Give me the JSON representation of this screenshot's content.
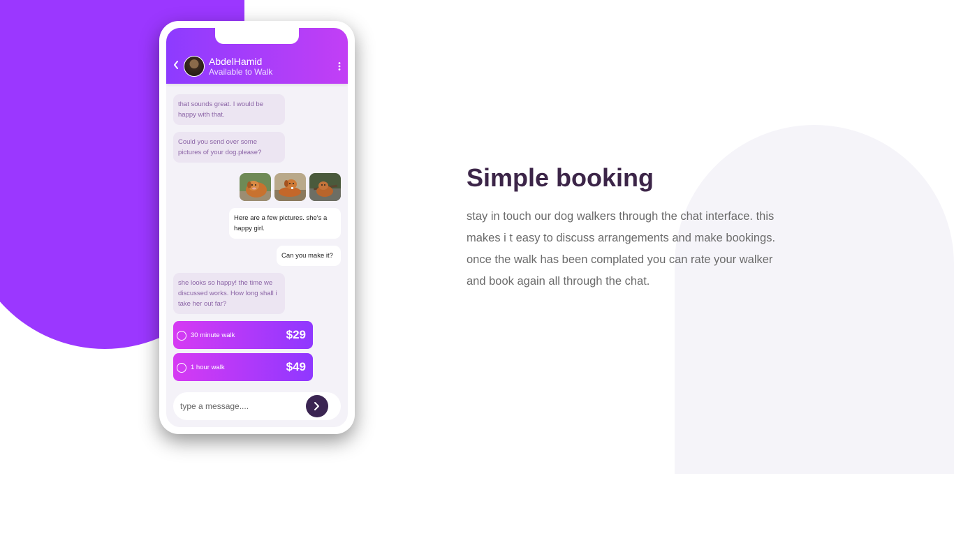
{
  "chat": {
    "contact_name": "AbdelHamid",
    "contact_status": "Available to Walk",
    "messages": [
      {
        "side": "in",
        "text": "that sounds great. I would be happy with that."
      },
      {
        "side": "in",
        "text": "Could you send over some pictures of your dog.please?"
      },
      {
        "side": "out",
        "text": "Here are a few pictures. she's a happy girl."
      },
      {
        "side": "out",
        "text": "Can you make it?"
      },
      {
        "side": "in",
        "text": "she looks so happy! the time we discussed works. How long shall i take her out far?"
      }
    ],
    "options": [
      {
        "label": "30 minute walk",
        "price": "$29"
      },
      {
        "label": "1 hour walk",
        "price": "$49"
      }
    ],
    "input_placeholder": "type a message...."
  },
  "feature": {
    "title": "Simple booking",
    "description": "stay in touch our dog walkers through the chat interface. this makes i t easy to discuss arrangements and make bookings. once the walk has been complated you can rate your walker and book again all through the chat."
  },
  "colors": {
    "purple_accent": "#9b37ff",
    "header_gradient_start": "#8d3bff",
    "header_gradient_end": "#c23ff5",
    "title_text": "#3c2548",
    "send_button": "#3b2552"
  },
  "icons": {
    "back": "chevron-left-icon",
    "more": "vertical-dots-icon",
    "send": "chevron-right-icon"
  }
}
